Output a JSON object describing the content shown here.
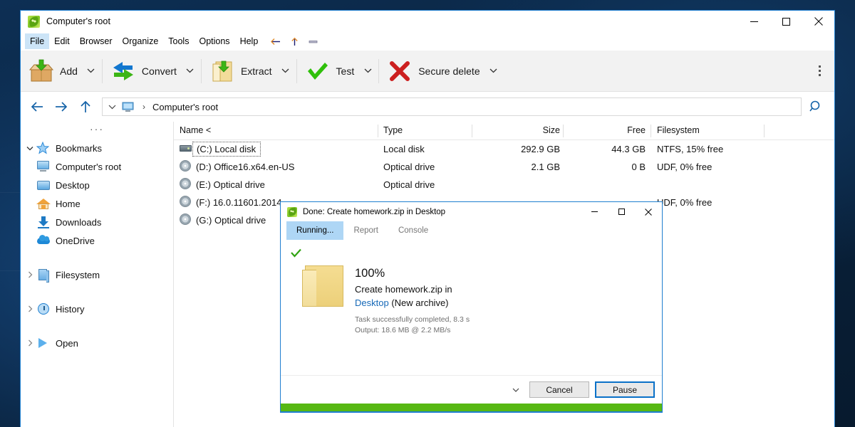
{
  "window": {
    "title": "Computer's root",
    "icon": "peazip-icon",
    "controls": {
      "minimize": "minimize-icon",
      "maximize": "maximize-icon",
      "close": "close-icon"
    }
  },
  "menubar": {
    "items": [
      "File",
      "Edit",
      "Browser",
      "Organize",
      "Tools",
      "Options",
      "Help"
    ],
    "selected": "File",
    "nav_icons": [
      "back-arrow-icon",
      "up-arrow-icon",
      "minus-icon"
    ]
  },
  "toolbar": {
    "buttons": [
      {
        "label": "Add",
        "icon": "add-archive-icon",
        "caret": "chevron-down-icon"
      },
      {
        "label": "Convert",
        "icon": "convert-icon",
        "caret": "chevron-down-icon"
      },
      {
        "label": "Extract",
        "icon": "extract-icon",
        "caret": "chevron-down-icon"
      },
      {
        "label": "Test",
        "icon": "test-checkmark-icon",
        "caret": "chevron-down-icon"
      },
      {
        "label": "Secure delete",
        "icon": "secure-delete-x-icon",
        "caret": "chevron-down-icon"
      }
    ],
    "overflow": "more-options-icon"
  },
  "addressbar": {
    "back": "back-arrow-icon",
    "forward": "forward-arrow-icon",
    "up": "up-arrow-icon",
    "dropdown": "chevron-down-icon",
    "location_icon": "computer-icon",
    "separator": "›",
    "path": "Computer's root",
    "search": "search-icon"
  },
  "sidebar": {
    "dots": "···",
    "groups": [
      {
        "label": "Bookmarks",
        "icon": "star-icon",
        "twisty": "⌄",
        "expanded": true,
        "children": [
          {
            "label": "Computer's root",
            "icon": "computer-icon"
          },
          {
            "label": "Desktop",
            "icon": "desktop-icon"
          },
          {
            "label": "Home",
            "icon": "home-icon"
          },
          {
            "label": "Downloads",
            "icon": "downloads-icon"
          },
          {
            "label": "OneDrive",
            "icon": "onedrive-cloud-icon"
          }
        ]
      },
      {
        "label": "Filesystem",
        "icon": "filesystem-icon",
        "twisty": "›",
        "expanded": false,
        "children": []
      },
      {
        "label": "History",
        "icon": "history-clock-icon",
        "twisty": "›",
        "expanded": false,
        "children": []
      },
      {
        "label": "Open",
        "icon": "open-play-icon",
        "twisty": "›",
        "expanded": false,
        "children": []
      }
    ]
  },
  "filelist": {
    "columns": [
      "Name <",
      "Type",
      "Size",
      "Free",
      "Filesystem"
    ],
    "rows": [
      {
        "icon": "hard-disk-icon",
        "name": "(C:) Local disk",
        "type": "Local disk",
        "size": "292.9 GB",
        "free": "44.3 GB",
        "filesystem": "NTFS, 15% free",
        "focused": true
      },
      {
        "icon": "optical-disc-icon",
        "name": "(D:) Office16.x64.en-US",
        "type": "Optical drive",
        "size": "2.1 GB",
        "free": "0 B",
        "filesystem": "UDF, 0% free",
        "focused": false
      },
      {
        "icon": "optical-disc-icon",
        "name": "(E:) Optical drive",
        "type": "Optical drive",
        "size": "",
        "free": "",
        "filesystem": "",
        "focused": false
      },
      {
        "icon": "optical-disc-icon",
        "name": "(F:) 16.0.11601.2014",
        "type": "",
        "size": "",
        "free": "",
        "filesystem": "UDF, 0% free",
        "focused": false
      },
      {
        "icon": "optical-disc-icon",
        "name": "(G:) Optical drive",
        "type": "",
        "size": "",
        "free": "",
        "filesystem": "",
        "focused": false
      }
    ]
  },
  "dialog": {
    "icon": "peazip-icon",
    "title": "Done: Create homework.zip in Desktop",
    "controls": {
      "minimize": "minimize-icon",
      "maximize": "maximize-icon",
      "close": "close-icon"
    },
    "tabs": [
      {
        "label": "Running...",
        "active": true
      },
      {
        "label": "Report",
        "active": false
      },
      {
        "label": "Console",
        "active": false
      }
    ],
    "status_icon": "green-checkmark-icon",
    "folder_icon": "folder-icon",
    "percent": "100%",
    "task_line": "Create homework.zip in",
    "destination": "Desktop",
    "destination_suffix": " (New archive)",
    "detail_1": "Task successfully completed, 8.3 s",
    "detail_2": "Output: 18.6 MB @ 2.2 MB/s",
    "footer_caret": "chevron-down-icon",
    "cancel_label": "Cancel",
    "pause_label": "Pause",
    "progress_percent": 100,
    "progress_color": "#57b813"
  },
  "colors": {
    "accent": "#1f7fd0",
    "selection": "#cce4f7",
    "tab_active": "#aed6f5",
    "link": "#1669b8",
    "progress_green": "#57b813",
    "toolbar_bg": "#f2f2f2",
    "desktop": "#0b2a4a"
  }
}
